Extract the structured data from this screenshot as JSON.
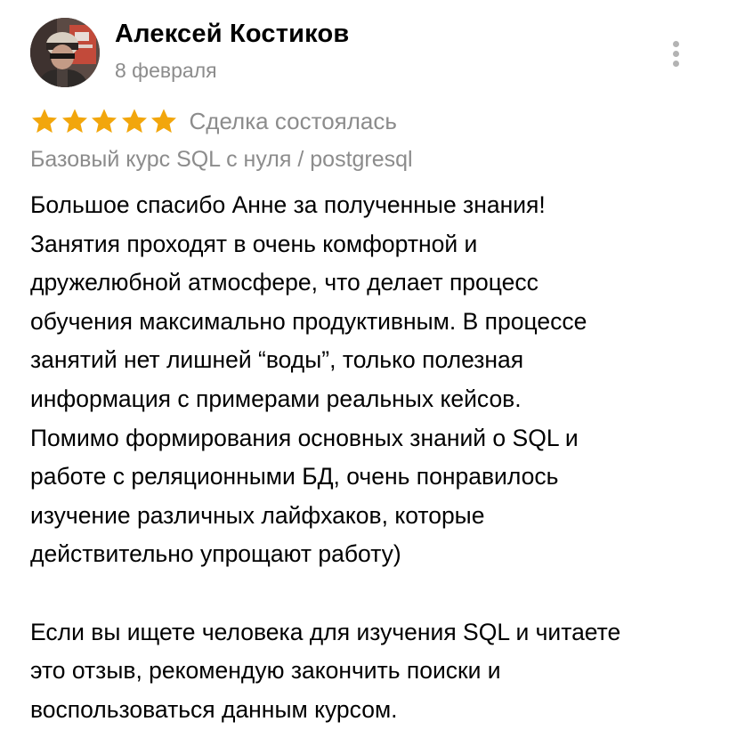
{
  "review": {
    "author": "Алексей Костиков",
    "date": "8 февраля",
    "rating": 5,
    "rating_max": 5,
    "status": "Сделка состоялась",
    "course": "Базовый курс SQL с нуля / postgresql",
    "text_lines_p1": [
      "Большое спасибо Анне за полученные знания!",
      "Занятия проходят в очень комфортной и",
      "дружелюбной атмосфере, что делает процесс",
      "обучения максимально продуктивным. В процессе",
      "занятий нет лишней “воды”, только полезная",
      "информация с примерами реальных кейсов.",
      "Помимо формирования основных знаний о SQL и",
      "работе с реляционными БД, очень понравилось",
      "изучение различных лайфхаков, которые",
      "действительно упрощают работу)"
    ],
    "text_lines_p2": [
      "Если вы ищете человека для изучения SQL и читаете",
      "это отзыв, рекомендую закончить поиски  и",
      "воспользоваться данным курсом."
    ]
  },
  "icons": {
    "star": "star-icon",
    "more": "more-vertical-icon",
    "avatar": "user-avatar-photo"
  },
  "colors": {
    "star": "#f2a60c",
    "secondary_text": "#8c8c8c",
    "primary_text": "#000000",
    "menu_dots": "#b3b3b3"
  }
}
